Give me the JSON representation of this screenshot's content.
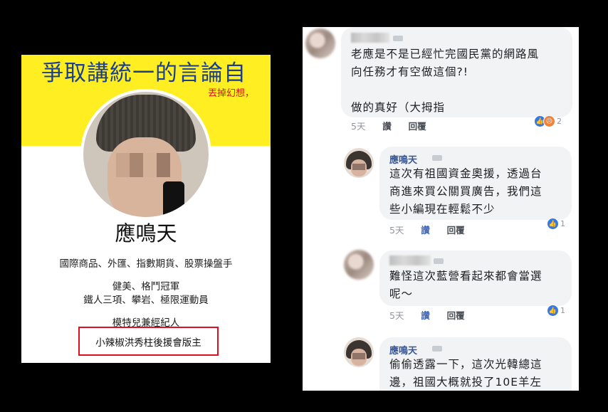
{
  "profile": {
    "cover_headline": "爭取講統一的言論自",
    "cover_subline": "丟掉幻想，",
    "name": "應鳴天",
    "bio_line1": "國際商品、外匯、指數期貨、股票操盤手",
    "bio_line2": "健美、格鬥冠軍",
    "bio_line3": "鐵人三項、攀岩、極限運動員",
    "bio_line4": "模特兒兼經紀人",
    "bio_highlight": "小辣椒洪秀柱後援會版主"
  },
  "comments": [
    {
      "author": "",
      "text": "老應是不是已經忙完國民黨的網路風\n向任務才有空做這個?!\n\n做的真好（大拇指",
      "time": "5天",
      "like_label": "讚",
      "reply_label": "回覆",
      "reactions": [
        "like-icon",
        "angry-icon"
      ],
      "reaction_count": "2"
    },
    {
      "author": "應鳴天",
      "text": "這次有祖國資金奧援，透過台\n商進來買公關買廣告，我們這\n些小編現在輕鬆不少",
      "time": "5天",
      "like_label": "讚",
      "reply_label": "回覆",
      "reactions": [
        "like-icon"
      ],
      "reaction_count": "1"
    },
    {
      "author": "",
      "text": "難怪這次藍營看起來都會當選\n呢～",
      "time": "5天",
      "like_label": "讚",
      "reply_label": "回覆",
      "reactions": [
        "like-icon"
      ],
      "reaction_count": "1"
    },
    {
      "author": "應鳴天",
      "text": "偷偷透露一下，這次光韓總這\n邊，祖國大概就投了10E羊左",
      "time": "",
      "like_label": "",
      "reply_label": "",
      "reactions": [],
      "reaction_count": ""
    }
  ],
  "colors": {
    "highlight_border": "#e10f1e",
    "cover_bg": "#ffee22",
    "link_blue": "#385898",
    "like_blue": "#3578e5"
  }
}
